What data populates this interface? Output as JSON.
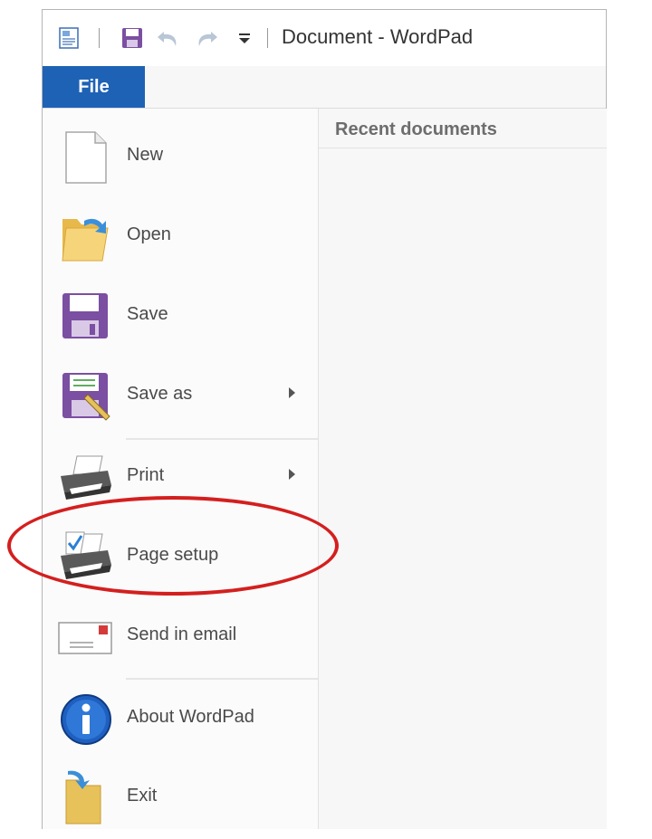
{
  "window": {
    "title": "Document - WordPad"
  },
  "tabs": {
    "file": "File"
  },
  "recent": {
    "header": "Recent documents"
  },
  "menu": [
    {
      "id": "new",
      "label": "New",
      "icon": "new-document-icon",
      "submenu": false
    },
    {
      "id": "open",
      "label": "Open",
      "icon": "open-folder-icon",
      "submenu": false
    },
    {
      "id": "save",
      "label": "Save",
      "icon": "floppy-disk-icon",
      "submenu": false
    },
    {
      "id": "save-as",
      "label": "Save as",
      "icon": "save-as-icon",
      "submenu": true
    },
    {
      "id": "print",
      "label": "Print",
      "icon": "printer-icon",
      "submenu": true
    },
    {
      "id": "page-setup",
      "label": "Page setup",
      "icon": "page-setup-icon",
      "submenu": false
    },
    {
      "id": "send-email",
      "label": "Send in email",
      "icon": "email-envelope-icon",
      "submenu": false
    },
    {
      "id": "about",
      "label": "About WordPad",
      "icon": "info-icon",
      "submenu": false
    },
    {
      "id": "exit",
      "label": "Exit",
      "icon": "exit-icon",
      "submenu": false
    }
  ],
  "annotation": {
    "highlighted_item": "page-setup",
    "color": "#d41f1f"
  },
  "colors": {
    "file_tab": "#1e62b5",
    "menu_bg": "#fbfbfb",
    "recent_bg": "#f7f7f7"
  }
}
